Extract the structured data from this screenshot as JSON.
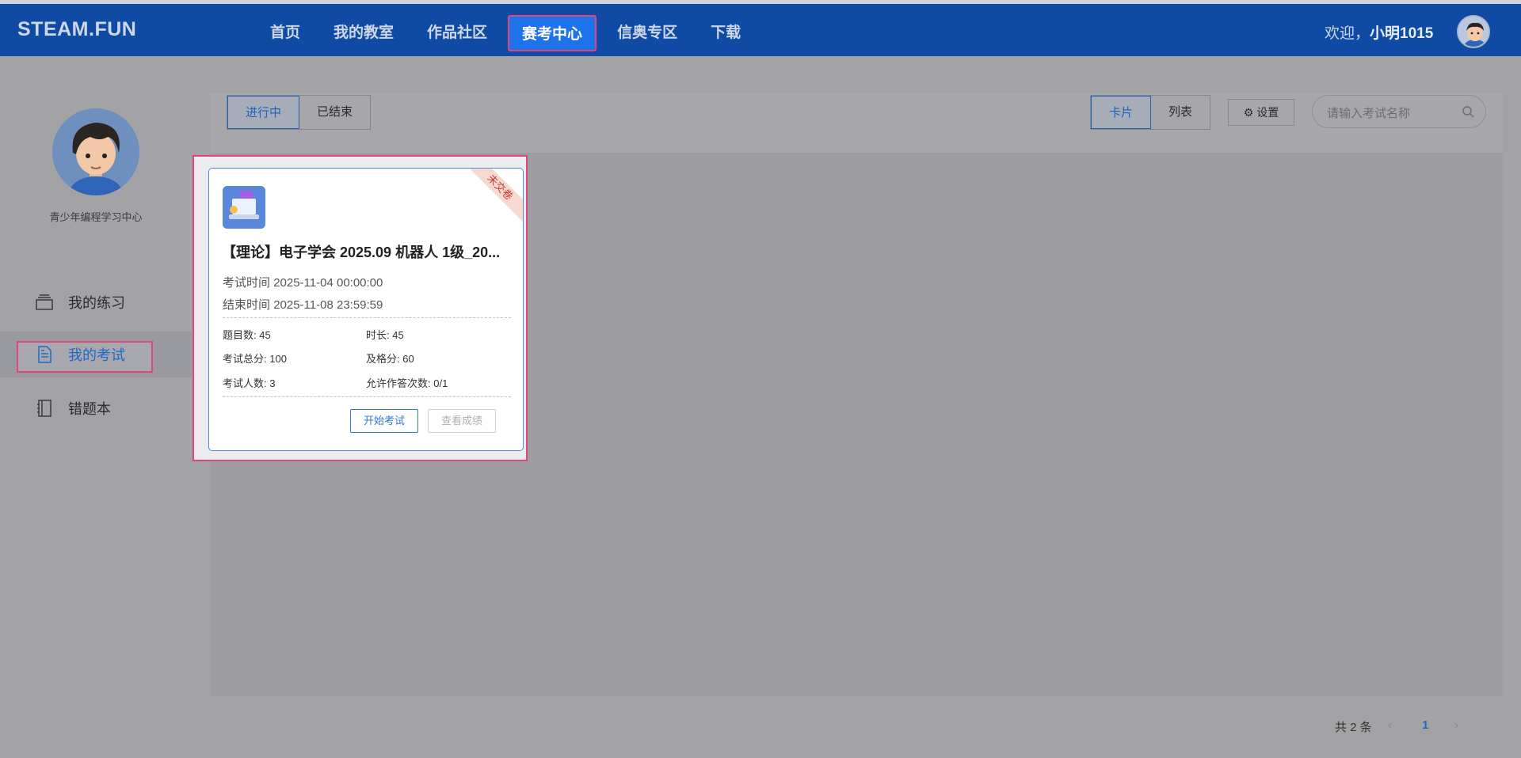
{
  "header": {
    "logo": "STEAM.FUN",
    "nav": [
      "首页",
      "我的教室",
      "作品社区",
      "赛考中心",
      "信奥专区",
      "下载"
    ],
    "active_nav_index": 3,
    "welcome_prefix": "欢迎，",
    "username": "小明1015"
  },
  "sidebar": {
    "caption": "青少年编程学习中心",
    "items": [
      {
        "label": "我的练习",
        "icon": "layers-icon"
      },
      {
        "label": "我的考试",
        "icon": "document-icon"
      },
      {
        "label": "错题本",
        "icon": "notebook-icon"
      }
    ],
    "active_index": 1
  },
  "toolbar": {
    "status_tabs": [
      "进行中",
      "已结束"
    ],
    "active_status": "进行中",
    "view_tabs": [
      "卡片",
      "列表"
    ],
    "active_view": "卡片",
    "settings_label": "设置",
    "search_placeholder": "请输入考试名称"
  },
  "exam_card": {
    "ribbon": "未交卷",
    "title": "【理论】电子学会 2025.09 机器人 1级_20...",
    "start_time_label": "考试时间",
    "start_time": "2025-11-04 00:00:00",
    "end_time_label": "结束时间",
    "end_time": "2025-11-08 23:59:59",
    "stats": [
      {
        "label": "题目数",
        "value": "45"
      },
      {
        "label": "时长",
        "value": "45"
      },
      {
        "label": "考试总分",
        "value": "100"
      },
      {
        "label": "及格分",
        "value": "60"
      },
      {
        "label": "考试人数",
        "value": "3"
      },
      {
        "label": "允许作答次数",
        "value": "0/1"
      }
    ],
    "start_button": "开始考试",
    "view_button": "查看成绩"
  },
  "pagination": {
    "total_text": "共 2 条",
    "current_page": "1"
  }
}
